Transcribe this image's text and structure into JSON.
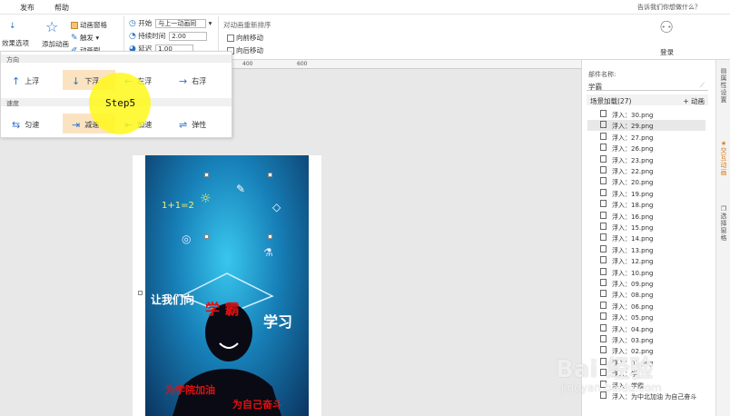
{
  "menubar": {
    "items": [
      "发布",
      "帮助"
    ],
    "tell_me": "告诉我们你想做什么？"
  },
  "ribbon": {
    "effect_options": "效果选项",
    "add_animation": "添加动画",
    "animation_pane": "动画窗格",
    "trigger": "触发",
    "anim_painter": "动画刷",
    "start_label": "开始",
    "start_value": "与上一动画同",
    "duration_label": "持续时间",
    "duration_value": "2.00",
    "delay_label": "延迟",
    "delay_value": "1.00",
    "reorder_title": "对动画重新排序",
    "move_earlier": "向前移动",
    "move_later": "向后移动",
    "login": "登录"
  },
  "ruler": [
    "400",
    "600"
  ],
  "popup": {
    "direction_title": "方向",
    "direction_options": [
      "上浮",
      "下浮",
      "左浮",
      "右浮"
    ],
    "speed_title": "速度",
    "speed_options": [
      "匀速",
      "减速",
      "加速",
      "弹性"
    ],
    "step_label": "Step5"
  },
  "poster": {
    "text_let": "让我们向",
    "text_xueba": "学 霸",
    "text_study": "学习",
    "text_college": "为学院加油",
    "text_self": "为自己奋斗",
    "formula": "1+1=2"
  },
  "right_panel": {
    "component_label": "部件名称:",
    "component_value": "学霸",
    "scene_label": "场景加载(27)",
    "add_anim": "+ 动画",
    "rows": [
      "浮入：30.png",
      "浮入：29.png",
      "浮入：27.png",
      "浮入：26.png",
      "浮入：23.png",
      "浮入：22.png",
      "浮入：20.png",
      "浮入：19.png",
      "浮入：18.png",
      "浮入：16.png",
      "浮入：15.png",
      "浮入：14.png",
      "浮入：13.png",
      "浮入：12.png",
      "浮入：10.png",
      "浮入：09.png",
      "浮入：08.png",
      "浮入：06.png",
      "浮入：05.png",
      "浮入：04.png",
      "浮入：03.png",
      "浮入：02.png",
      "浮入：01.png",
      "浮入：学",
      "浮入：学霸",
      "浮入：为中北加油 为自己奋斗"
    ]
  },
  "side_tabs": [
    "属性设置",
    "交互动画",
    "选择窗格"
  ],
  "watermark": "Bai 经验",
  "watermark_url": "jingyan.baidu.com",
  "colors": {
    "accent": "#e07b12",
    "selected": "#fbe3c2",
    "poster_red": "#e01010"
  }
}
